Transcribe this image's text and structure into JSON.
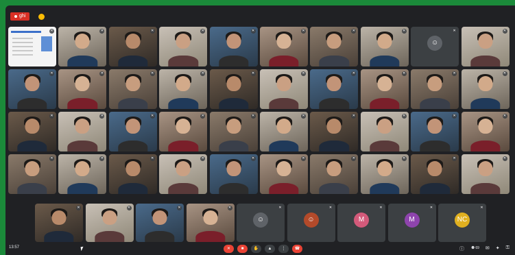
{
  "header": {
    "rec_label": "● ghi",
    "title": "",
    "accent": "#1b8a3a"
  },
  "tiles": [],
  "footer": {
    "clock": "13:57",
    "meeting_code": "",
    "controls": [
      {
        "icon": "mic-off-icon",
        "glyph": "✕",
        "color": "#ea4335"
      },
      {
        "icon": "camera-off-icon",
        "glyph": "■",
        "color": "#ea4335"
      },
      {
        "icon": "raise-hand-icon",
        "glyph": "✋",
        "color": "#3c4043"
      },
      {
        "icon": "present-icon",
        "glyph": "▲",
        "color": "#3c4043"
      },
      {
        "icon": "more-options-icon",
        "glyph": "⋮",
        "color": "#3c4043"
      },
      {
        "icon": "leave-call-icon",
        "glyph": "☎",
        "color": "#ea4335"
      }
    ],
    "right_icons": [
      "info-icon",
      "people-icon",
      "chat-icon",
      "activities-icon",
      "lock-icon"
    ],
    "participant_count": "69"
  }
}
